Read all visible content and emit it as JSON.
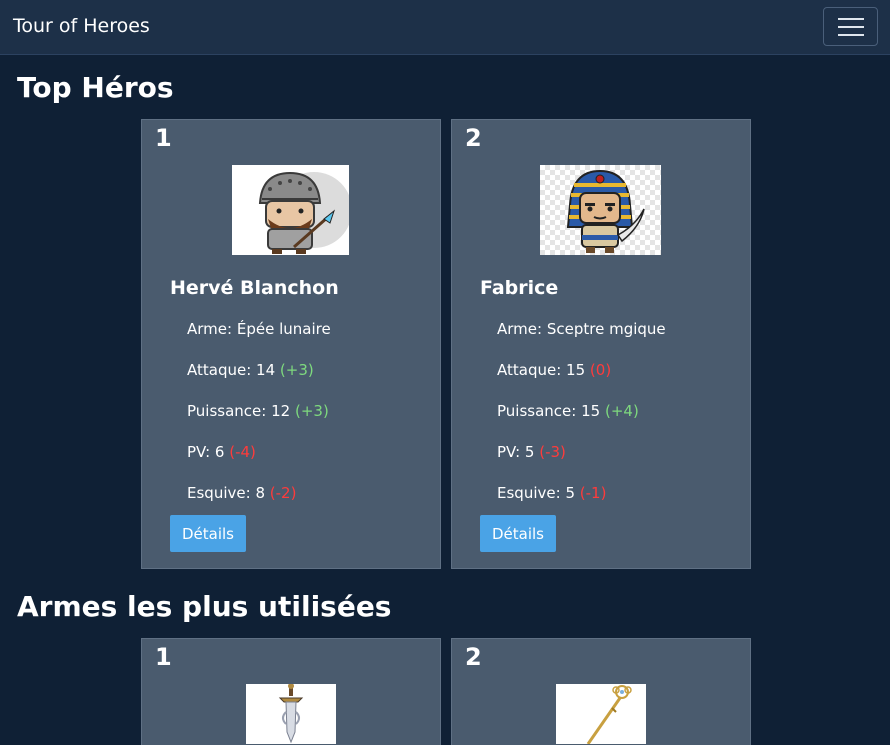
{
  "navbar": {
    "brand": "Tour of Heroes",
    "menu_icon": "hamburger-menu-icon"
  },
  "top_heroes": {
    "title": "Top Héros",
    "heroes": [
      {
        "rank": "1",
        "name": "Hervé Blanchon",
        "image_icon": "soldier-with-spear-icon",
        "weapon_label": "Arme:",
        "weapon": "Épée lunaire",
        "attack_label": "Attaque:",
        "attack": "14",
        "attack_mod": "(+3)",
        "power_label": "Puissance:",
        "power": "12",
        "power_mod": "(+3)",
        "hp_label": "PV:",
        "hp": "6",
        "hp_mod": "(-4)",
        "dodge_label": "Esquive:",
        "dodge": "8",
        "dodge_mod": "(-2)",
        "details_label": "Détails"
      },
      {
        "rank": "2",
        "name": "Fabrice",
        "image_icon": "pharaoh-with-sword-icon",
        "weapon_label": "Arme:",
        "weapon": "Sceptre mgique",
        "attack_label": "Attaque:",
        "attack": "15",
        "attack_mod": "(0)",
        "power_label": "Puissance:",
        "power": "15",
        "power_mod": "(+4)",
        "hp_label": "PV:",
        "hp": "5",
        "hp_mod": "(-3)",
        "dodge_label": "Esquive:",
        "dodge": "5",
        "dodge_mod": "(-1)",
        "details_label": "Détails"
      }
    ]
  },
  "top_weapons": {
    "title": "Armes les plus utilisées",
    "weapons": [
      {
        "rank": "1",
        "image_icon": "sword-icon"
      },
      {
        "rank": "2",
        "image_icon": "scepter-icon"
      }
    ]
  },
  "colors": {
    "background": "#0f2035",
    "navbar": "#1d3048",
    "card": "#4a5b6e",
    "button": "#4aa3e6",
    "positive": "#7ed97e",
    "negative": "#ff3b3b"
  }
}
